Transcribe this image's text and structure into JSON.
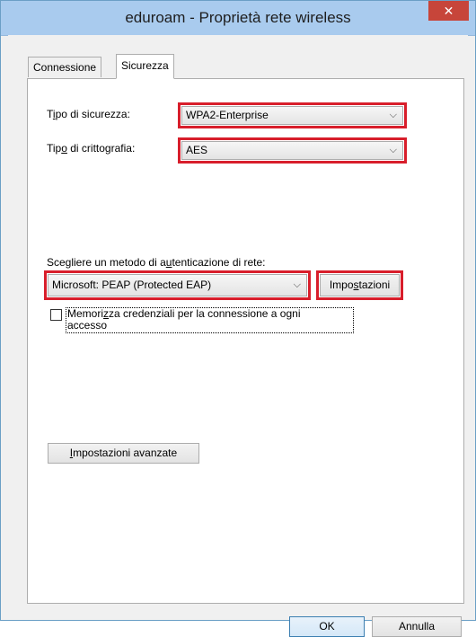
{
  "window": {
    "title": "eduroam - Proprietà rete wireless",
    "close_glyph": "✕"
  },
  "tabs": [
    {
      "label": "Connessione",
      "selected": false
    },
    {
      "label": "Sicurezza",
      "selected": true
    }
  ],
  "security": {
    "type_label_pre": "T",
    "type_label_ul": "i",
    "type_label_post": "po di sicurezza:",
    "type_value": "WPA2-Enterprise",
    "encryption_label_pre": "Tip",
    "encryption_label_ul": "o",
    "encryption_label_post": " di crittografia:",
    "encryption_value": "AES",
    "auth_label_pre": "Scegliere un metodo di a",
    "auth_label_ul": "u",
    "auth_label_post": "tenticazione di rete:",
    "auth_method_value": "Microsoft: PEAP (Protected EAP)",
    "settings_label_pre": "Impo",
    "settings_label_ul": "s",
    "settings_label_post": "tazioni",
    "remember_label_pre": "Memori",
    "remember_label_ul": "z",
    "remember_label_post": "za credenziali per la connessione a ogni",
    "remember_label_line2": "accesso",
    "remember_checked": false,
    "advanced_label_pre": "",
    "advanced_label_ul": "I",
    "advanced_label_post": "mpostazioni avanzate"
  },
  "footer": {
    "ok_label": "OK",
    "cancel_label": "Annulla"
  },
  "icons": {
    "dropdown": "chevron-down-icon",
    "close": "close-icon"
  },
  "colors": {
    "titlebar": "#a9cbee",
    "close": "#c7453a",
    "highlight": "#d81e2b"
  }
}
